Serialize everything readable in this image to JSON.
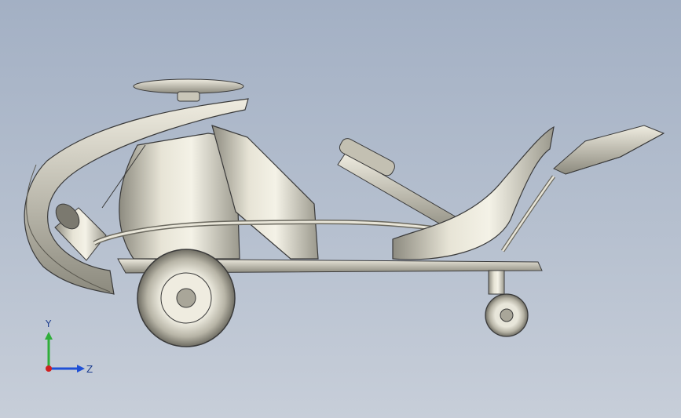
{
  "viewport": {
    "background_top": "#a3b0c4",
    "background_bottom": "#c7ced9",
    "model_color": "#d6d3c4",
    "edge_color": "#3a3a3a"
  },
  "axis_triad": {
    "y_label": "Y",
    "z_label": "Z",
    "y_color": "#2fae3a",
    "z_color": "#1f50d6",
    "x_color": "#d02020"
  }
}
